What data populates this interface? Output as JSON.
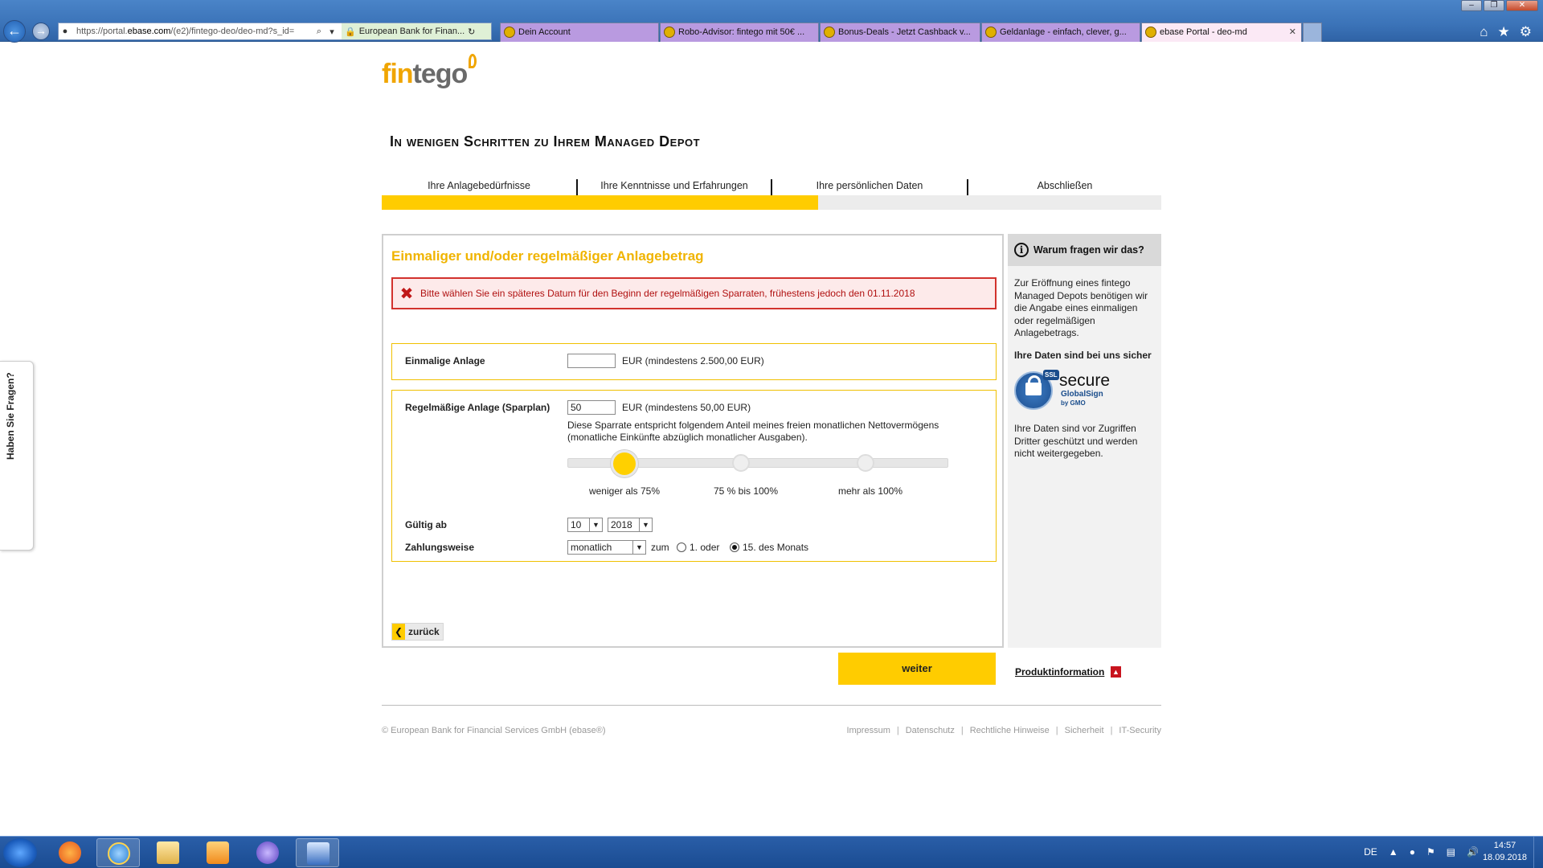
{
  "browser": {
    "url_prefix": "https://portal.",
    "url_domain": "ebase.com",
    "url_rest": "/(e2)/fintego-deo/deo-md?s_id=",
    "cert_label": "European Bank for Finan...",
    "tabs": [
      {
        "label": "Dein Account"
      },
      {
        "label": "Robo-Advisor: fintego mit 50€ ..."
      },
      {
        "label": "Bonus-Deals - Jetzt Cashback v..."
      },
      {
        "label": "Geldanlage - einfach, clever, g..."
      },
      {
        "label": "ebase Portal - deo-md"
      }
    ]
  },
  "logo": {
    "part1": "fin",
    "part2": "tego"
  },
  "headline": "In wenigen Schritten zu Ihrem Managed Depot",
  "steps": [
    {
      "label": "Ihre Anlagebedürfnisse"
    },
    {
      "label": "Ihre Kenntnisse und Erfahrungen"
    },
    {
      "label": "Ihre persönlichen Daten"
    },
    {
      "label": "Abschließen"
    }
  ],
  "progress_fraction": 0.56,
  "form": {
    "title": "Einmaliger und/oder regelmäßiger Anlagebetrag",
    "error": "Bitte wählen Sie ein späteres Datum für den Beginn der regelmäßigen Sparraten, frühestens jedoch den 01.11.2018",
    "one_time": {
      "label": "Einmalige Anlage",
      "value": "",
      "hint": "EUR (mindestens 2.500,00 EUR)"
    },
    "regular": {
      "label": "Regelmäßige Anlage (Sparplan)",
      "value": "50",
      "hint": "EUR (mindestens 50,00 EUR)"
    },
    "description": "Diese Sparrate entspricht folgendem Anteil meines freien monatlichen Nettovermögens (monatliche Einkünfte abzüglich monatlicher Ausgaben).",
    "slider_labels": [
      "weniger als 75%",
      "75 % bis 100%",
      "mehr als 100%"
    ],
    "slider_selected_index": 0,
    "valid_from": {
      "label": "Gültig ab",
      "month": "10",
      "year": "2018"
    },
    "payment": {
      "label": "Zahlungsweise",
      "value": "monatlich",
      "zum": "zum",
      "option1": "1. oder",
      "option2": "15. des Monats",
      "selected": "option2"
    },
    "back_label": "zurück",
    "next_label": "weiter"
  },
  "side": {
    "title": "Warum fragen wir das?",
    "text": "Zur Eröffnung eines fintego Managed Depots benötigen wir die Angabe eines einmaligen oder regelmäßigen Anlagebetrags.",
    "secure_title": "Ihre Daten sind bei uns sicher",
    "seal_ssl": "SSL",
    "seal_word": "secure",
    "seal_brand": "GlobalSign",
    "seal_by": "by GMO",
    "secure_text": "Ihre Daten sind vor Zugriffen Dritter geschützt und werden nicht weitergegeben.",
    "product_info": "Produktinformation"
  },
  "side_tab": "Haben Sie Fragen?",
  "footer": {
    "copyright": "© European Bank for Financial Services GmbH (ebase®)",
    "links": [
      "Impressum",
      "Datenschutz",
      "Rechtliche Hinweise",
      "Sicherheit",
      "IT-Security"
    ]
  },
  "taskbar": {
    "lang": "DE",
    "time": "14:57",
    "date": "18.09.2018"
  },
  "colors": {
    "accent": "#ffcc00",
    "brand": "#f0a500",
    "error": "#d2322d"
  }
}
